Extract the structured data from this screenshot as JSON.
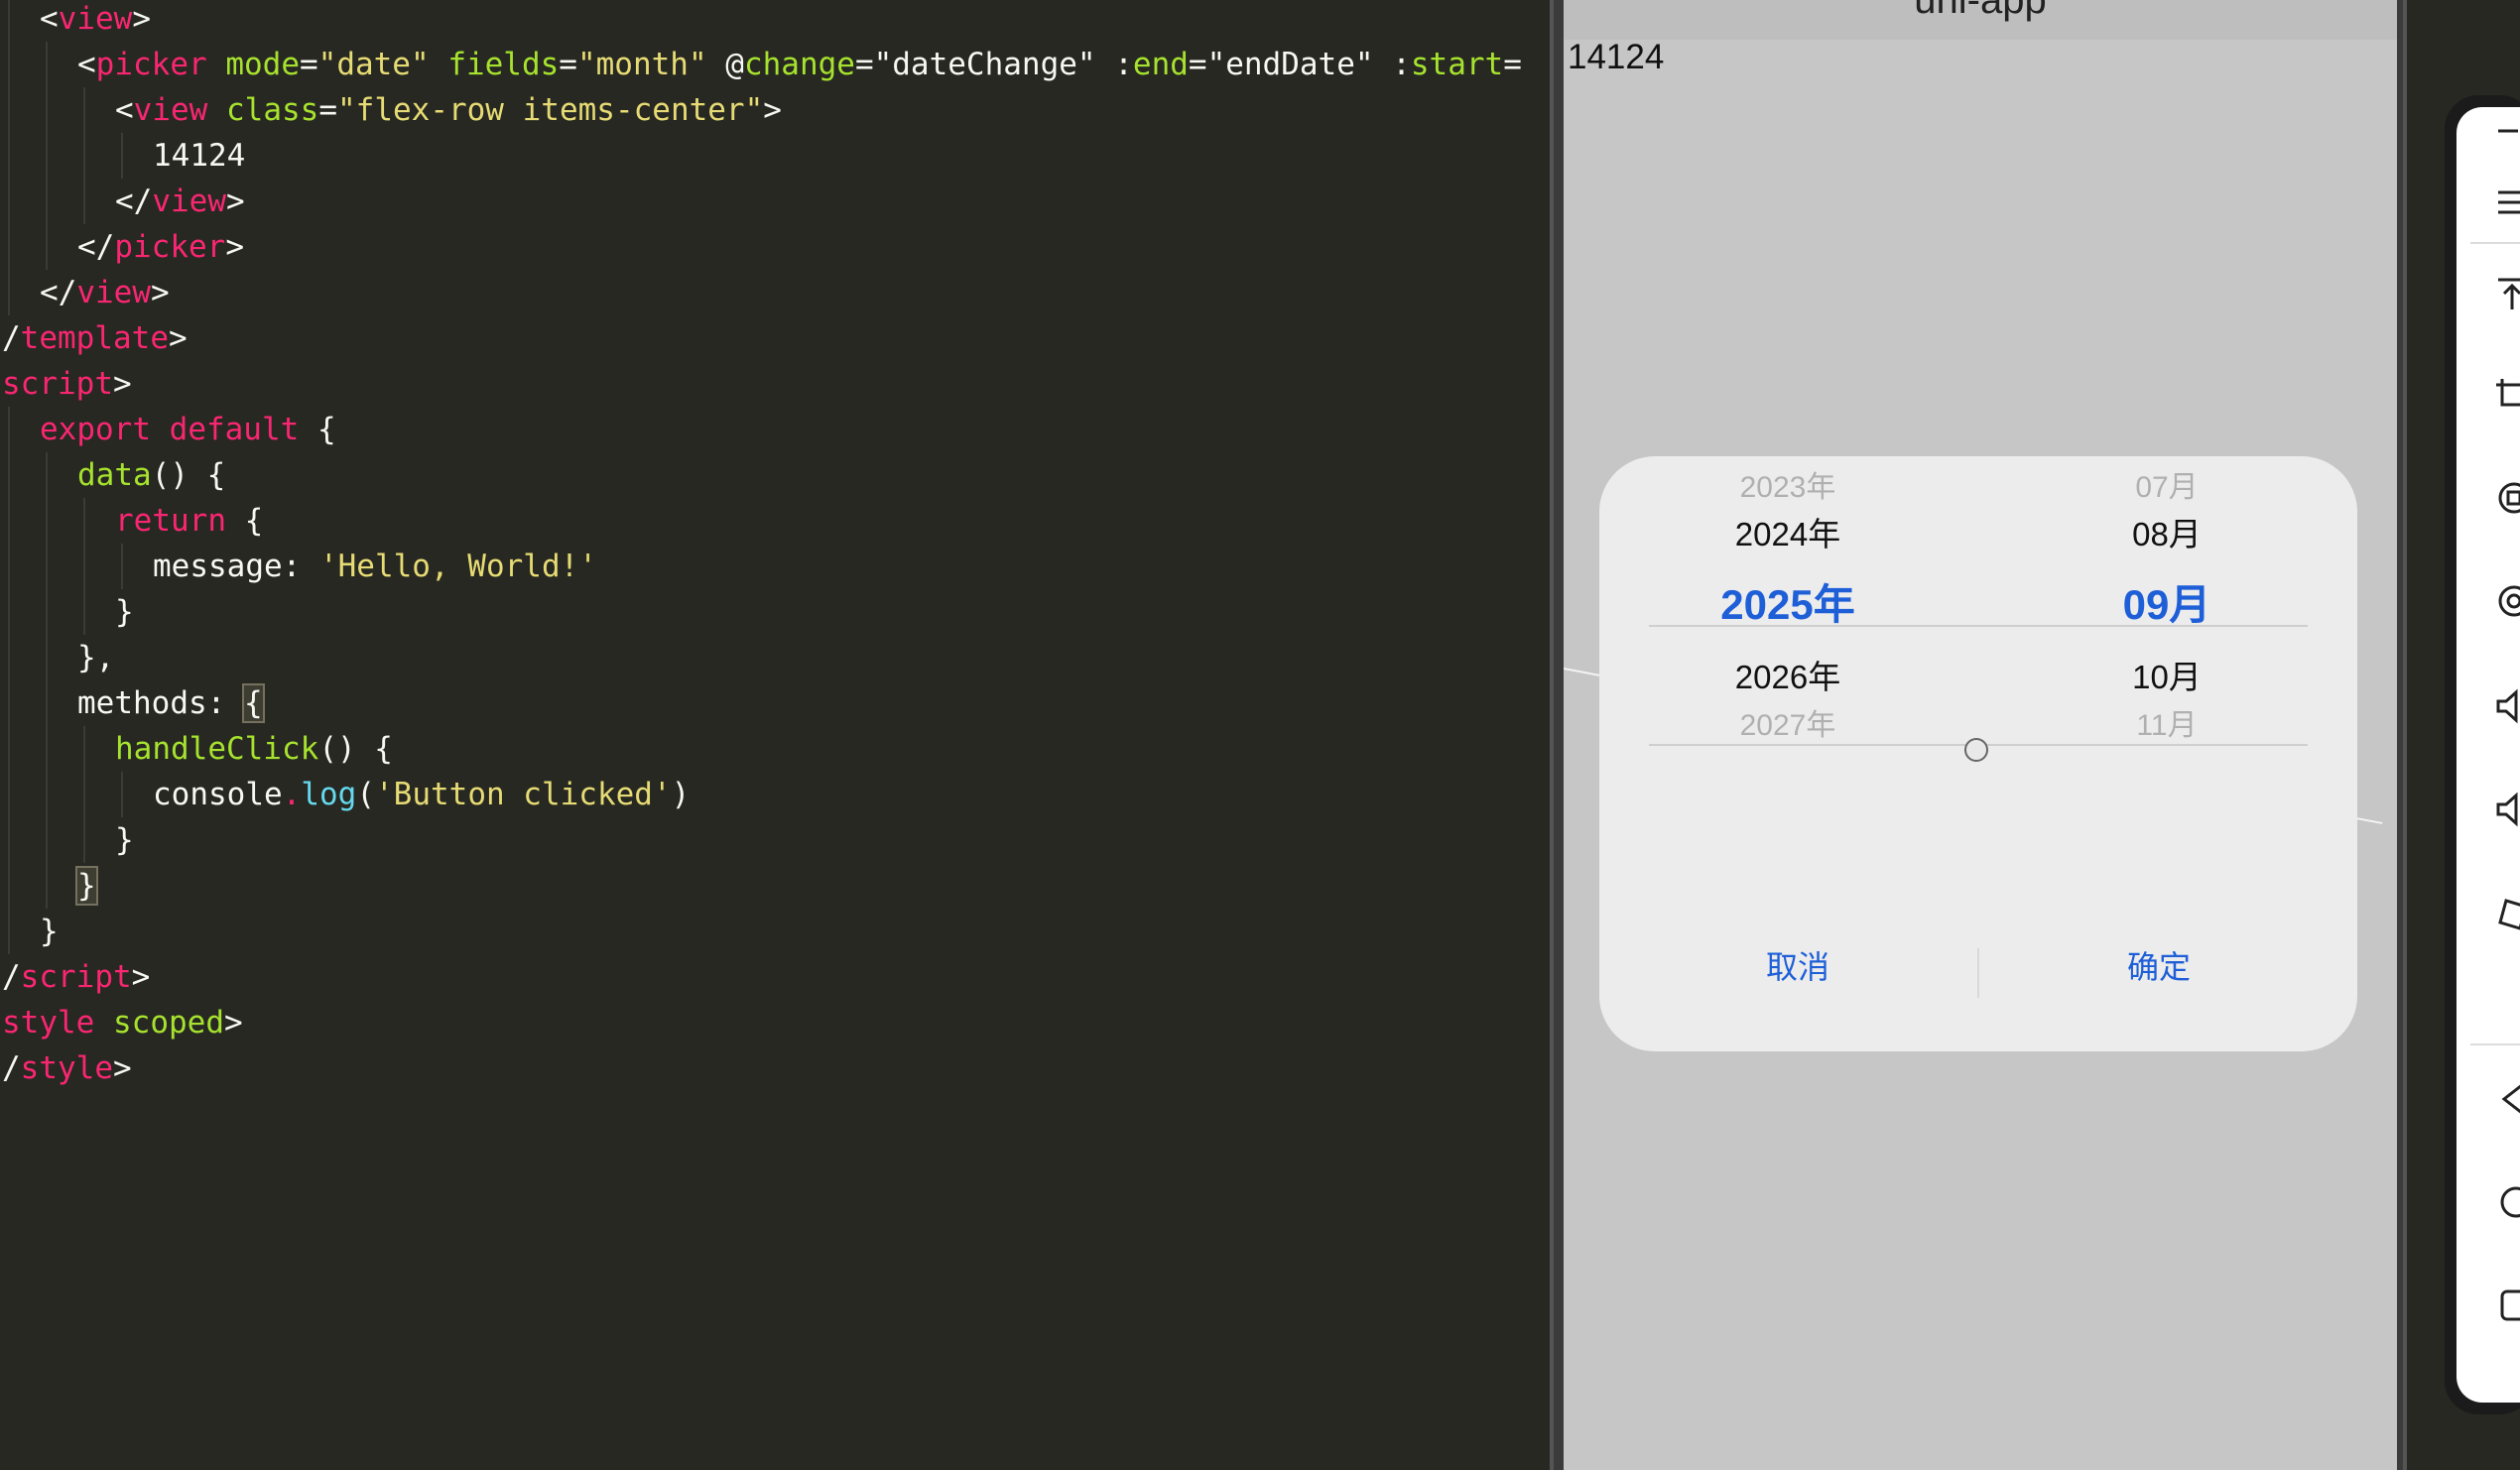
{
  "editor": {
    "lines": [
      {
        "indent": 1,
        "tokens": [
          {
            "t": "<",
            "c": "p"
          },
          {
            "t": "view",
            "c": "tag"
          },
          {
            "t": ">",
            "c": "p"
          }
        ]
      },
      {
        "indent": 2,
        "tokens": [
          {
            "t": "<",
            "c": "p"
          },
          {
            "t": "picker",
            "c": "tag"
          },
          {
            "t": " ",
            "c": "p"
          },
          {
            "t": "mode",
            "c": "attr"
          },
          {
            "t": "=",
            "c": "p"
          },
          {
            "t": "\"date\"",
            "c": "str"
          },
          {
            "t": " ",
            "c": "p"
          },
          {
            "t": "fields",
            "c": "attr"
          },
          {
            "t": "=",
            "c": "p"
          },
          {
            "t": "\"month\"",
            "c": "str"
          },
          {
            "t": " @",
            "c": "p"
          },
          {
            "t": "change",
            "c": "attr"
          },
          {
            "t": "=\"dateChange\" :",
            "c": "p"
          },
          {
            "t": "end",
            "c": "attr"
          },
          {
            "t": "=\"endDate\" :",
            "c": "p"
          },
          {
            "t": "start",
            "c": "attr"
          },
          {
            "t": "=",
            "c": "p"
          }
        ]
      },
      {
        "indent": 3,
        "tokens": [
          {
            "t": "<",
            "c": "p"
          },
          {
            "t": "view",
            "c": "tag"
          },
          {
            "t": " ",
            "c": "p"
          },
          {
            "t": "class",
            "c": "attr"
          },
          {
            "t": "=",
            "c": "p"
          },
          {
            "t": "\"flex-row items-center\"",
            "c": "str"
          },
          {
            "t": ">",
            "c": "p"
          }
        ]
      },
      {
        "indent": 4,
        "tokens": [
          {
            "t": "14124",
            "c": "p"
          }
        ]
      },
      {
        "indent": 3,
        "tokens": [
          {
            "t": "</",
            "c": "p"
          },
          {
            "t": "view",
            "c": "tag"
          },
          {
            "t": ">",
            "c": "p"
          }
        ]
      },
      {
        "indent": 2,
        "tokens": [
          {
            "t": "</",
            "c": "p"
          },
          {
            "t": "picker",
            "c": "tag"
          },
          {
            "t": ">",
            "c": "p"
          }
        ]
      },
      {
        "indent": 1,
        "tokens": [
          {
            "t": "</",
            "c": "p"
          },
          {
            "t": "view",
            "c": "tag"
          },
          {
            "t": ">",
            "c": "p"
          }
        ]
      },
      {
        "indent": 0,
        "tokens": [
          {
            "t": "/",
            "c": "p"
          },
          {
            "t": "template",
            "c": "tag"
          },
          {
            "t": ">",
            "c": "p"
          }
        ]
      },
      {
        "indent": 0,
        "tokens": [
          {
            "t": "script",
            "c": "tag"
          },
          {
            "t": ">",
            "c": "p"
          }
        ]
      },
      {
        "indent": 1,
        "tokens": [
          {
            "t": "export",
            "c": "kw"
          },
          {
            "t": " ",
            "c": "p"
          },
          {
            "t": "default",
            "c": "kw"
          },
          {
            "t": " {",
            "c": "p"
          }
        ]
      },
      {
        "indent": 2,
        "tokens": [
          {
            "t": "data",
            "c": "fn"
          },
          {
            "t": "() {",
            "c": "p"
          }
        ]
      },
      {
        "indent": 3,
        "tokens": [
          {
            "t": "return",
            "c": "kw"
          },
          {
            "t": " {",
            "c": "p"
          }
        ]
      },
      {
        "indent": 4,
        "tokens": [
          {
            "t": "message: ",
            "c": "p"
          },
          {
            "t": "'Hello, World!'",
            "c": "str"
          }
        ]
      },
      {
        "indent": 3,
        "tokens": [
          {
            "t": "}",
            "c": "p"
          }
        ]
      },
      {
        "indent": 2,
        "tokens": [
          {
            "t": "},",
            "c": "p"
          }
        ]
      },
      {
        "indent": 2,
        "tokens": [
          {
            "t": "methods: ",
            "c": "p"
          },
          {
            "t": "{",
            "c": "hl"
          }
        ]
      },
      {
        "indent": 3,
        "tokens": [
          {
            "t": "handleClick",
            "c": "fn"
          },
          {
            "t": "() {",
            "c": "p"
          }
        ]
      },
      {
        "indent": 4,
        "tokens": [
          {
            "t": "console",
            "c": "p"
          },
          {
            "t": ".",
            "c": "kw"
          },
          {
            "t": "log",
            "c": "call"
          },
          {
            "t": "(",
            "c": "p"
          },
          {
            "t": "'Button clicked'",
            "c": "str"
          },
          {
            "t": ")",
            "c": "p"
          }
        ]
      },
      {
        "indent": 3,
        "tokens": [
          {
            "t": "}",
            "c": "p"
          }
        ]
      },
      {
        "indent": 2,
        "tokens": [
          {
            "t": "}",
            "c": "hl"
          }
        ]
      },
      {
        "indent": 1,
        "tokens": [
          {
            "t": "}",
            "c": "p"
          }
        ]
      },
      {
        "indent": 0,
        "tokens": [
          {
            "t": "/",
            "c": "p"
          },
          {
            "t": "script",
            "c": "tag"
          },
          {
            "t": ">",
            "c": "p"
          }
        ]
      },
      {
        "indent": 0,
        "tokens": [
          {
            "t": "style",
            "c": "tag"
          },
          {
            "t": " ",
            "c": "p"
          },
          {
            "t": "scoped",
            "c": "attr"
          },
          {
            "t": ">",
            "c": "p"
          }
        ]
      },
      {
        "indent": 0,
        "tokens": [
          {
            "t": "/",
            "c": "p"
          },
          {
            "t": "style",
            "c": "tag"
          },
          {
            "t": ">",
            "c": "p"
          }
        ]
      }
    ]
  },
  "phone": {
    "nav_title": "uni-app",
    "picker_value": "14124",
    "picker_dialog": {
      "years": [
        "2023年",
        "2024年",
        "2025年",
        "2026年",
        "2027年"
      ],
      "months": [
        "07月",
        "08月",
        "09月",
        "10月",
        "11月"
      ],
      "selected_year": "2025年",
      "selected_month": "09月",
      "cancel_label": "取消",
      "confirm_label": "确定",
      "accent_color": "#1e5fd8"
    }
  },
  "toolbar": {
    "icons": [
      "minimize-icon",
      "menu-icon",
      "pin-top-icon",
      "crop-icon",
      "screenshot-icon",
      "screen-record-icon",
      "volume-up-icon",
      "volume-down-icon",
      "rotate-icon",
      "back-icon",
      "home-icon",
      "recents-icon"
    ]
  }
}
